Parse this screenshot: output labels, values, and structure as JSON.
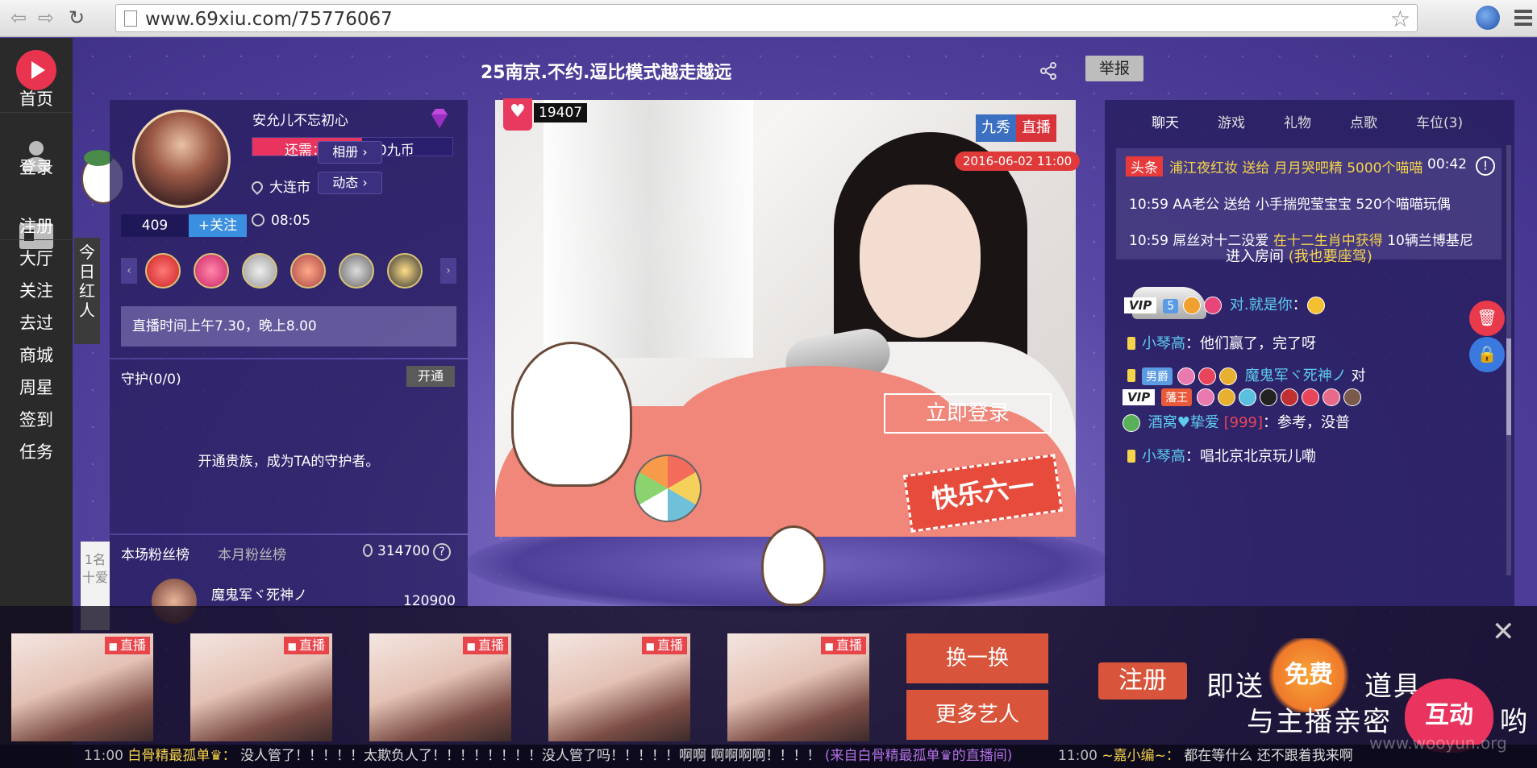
{
  "browser": {
    "url": "www.69xiu.com/75776067"
  },
  "site_nav": {
    "items": [
      "首页",
      "登录",
      "注册",
      "大厅",
      "关注",
      "去过",
      "商城",
      "周星",
      "签到",
      "任务"
    ]
  },
  "room": {
    "title": "25南京.不约.逗比模式越走越远",
    "report_label": "举报"
  },
  "side_tab": {
    "label": "今日红人",
    "rank_label": "1名十爱"
  },
  "host": {
    "name": "安允儿不忘初心",
    "need_text": "还需：2874500九币",
    "need_progress": 0.55,
    "location": "大连市",
    "time": "08:05",
    "album_label": "相册 ›",
    "feed_label": "动态 ›",
    "fans_count": "409",
    "follow_label": "+关注",
    "notice": "直播时间上午7.30，晚上8.00"
  },
  "guard": {
    "title": "守护(0/0)",
    "open_label": "开通",
    "message": "开通贵族，成为TA的守护者。"
  },
  "fans_rank": {
    "tab_current": "本场粉丝榜",
    "tab_month": "本月粉丝榜",
    "total": "314700",
    "top_name": "魔鬼军ヾ死神ノ",
    "top_score": "120900"
  },
  "video": {
    "like_count": "19407",
    "brand_a": "九秀",
    "brand_b": "直播",
    "datetime": "2016-06-02 11:00",
    "login_label": "立即登录",
    "sticker": "快乐六一"
  },
  "chat": {
    "tabs": [
      "聊天",
      "游戏",
      "礼物",
      "点歌",
      "车位(3)"
    ],
    "headline_tag": "头条",
    "headline": "浦江夜红妆 送给 月月哭吧精 5000个喵喵",
    "headline_time": "00:42",
    "sys1_time": "10:59",
    "sys1_text": "AA老公 送给 小手揣兜莹宝宝 520个喵喵玩偶",
    "sys2_time": "10:59",
    "sys2_user": "屌丝对十二没爱",
    "sys2_mid": "在十二生肖中获得",
    "sys2_end": "10辆兰博基尼",
    "enter_text": "进入房间",
    "enter_link": "(我也要座驾)",
    "msg1_user": "对.就是你",
    "msg1_colon": "：",
    "msg2_user": "小琴高",
    "msg2_text": "：他们赢了，完了呀",
    "msg3_badge": "男爵",
    "msg3_user": "魔鬼军ヾ死神ノ",
    "msg3_text": "对",
    "msg3_badge2": "藩王",
    "msg4_user": "酒窝♥挚爱",
    "msg4_tag": "[999]",
    "msg4_text": "：参考，没普",
    "msg5_user": "小琴高",
    "msg5_text": "：唱北京北京玩儿嘞",
    "level_badge": "5"
  },
  "recommend": {
    "live_label": "直播",
    "swap_label": "换一换",
    "more_label": "更多艺人"
  },
  "promo": {
    "register": "注册",
    "send_text": "即送",
    "free": "免费",
    "tools": "道具",
    "line2": "与主播亲密",
    "interact": "互动",
    "end": "哟"
  },
  "ticker": {
    "time1": "11:00",
    "user1": "白骨精最孤单♛：",
    "msg1": "没人管了！！！！！太欺负人了！！！！！！！！没人管了吗！！！！！啊啊 啊啊啊啊！！！！",
    "from1": "(来自白骨精最孤单♛的直播间)",
    "time2": "11:00",
    "user2": "~嘉小编~：",
    "msg2": "都在等什么 还不跟着我来啊"
  },
  "watermark": "www.wooyun.org",
  "colors": {
    "accent_red": "#e8345e",
    "brand_blue": "#3a6fc2",
    "nav_dark": "#2a2a2a",
    "panel_purple": "#2a1f6e",
    "highlight_yellow": "#f5d34a",
    "link_cyan": "#5dcbf0"
  },
  "icons": [
    "back-icon",
    "forward-icon",
    "reload-icon",
    "page-icon",
    "star-icon",
    "globe-icon",
    "menu-icon",
    "logo-icon",
    "user-icon",
    "register-card-icon",
    "share-icon",
    "diamond-icon",
    "location-icon",
    "clock-icon",
    "flame-icon",
    "question-icon",
    "heart-icon",
    "alert-icon",
    "trash-icon",
    "lock-icon",
    "close-icon"
  ]
}
